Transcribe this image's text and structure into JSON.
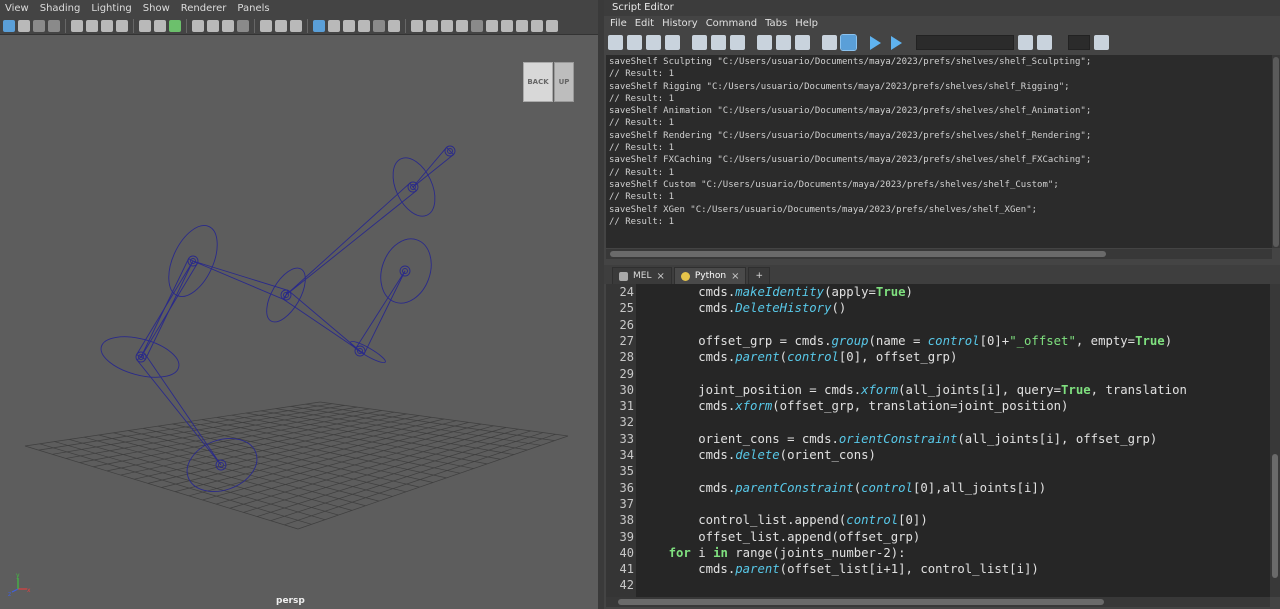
{
  "viewport": {
    "menu": [
      "View",
      "Shading",
      "Lighting",
      "Show",
      "Renderer",
      "Panels"
    ],
    "view_cube": {
      "back": "BACK",
      "up": "UP"
    },
    "camera_label": "persp",
    "axis_labels": {
      "x": "x",
      "y": "y",
      "z": "z"
    }
  },
  "script_editor": {
    "title": "Script Editor",
    "menu": [
      "File",
      "Edit",
      "History",
      "Command",
      "Tabs",
      "Help"
    ],
    "history_lines": [
      "saveShelf Sculpting \"C:/Users/usuario/Documents/maya/2023/prefs/shelves/shelf_Sculpting\";",
      "// Result: 1",
      "saveShelf Rigging \"C:/Users/usuario/Documents/maya/2023/prefs/shelves/shelf_Rigging\";",
      "// Result: 1",
      "saveShelf Animation \"C:/Users/usuario/Documents/maya/2023/prefs/shelves/shelf_Animation\";",
      "// Result: 1",
      "saveShelf Rendering \"C:/Users/usuario/Documents/maya/2023/prefs/shelves/shelf_Rendering\";",
      "// Result: 1",
      "saveShelf FXCaching \"C:/Users/usuario/Documents/maya/2023/prefs/shelves/shelf_FXCaching\";",
      "// Result: 1",
      "saveShelf Custom \"C:/Users/usuario/Documents/maya/2023/prefs/shelves/shelf_Custom\";",
      "// Result: 1",
      "saveShelf XGen \"C:/Users/usuario/Documents/maya/2023/prefs/shelves/shelf_XGen\";",
      "// Result: 1"
    ],
    "tabs": [
      {
        "label": "MEL",
        "active": false
      },
      {
        "label": "Python",
        "active": true
      }
    ],
    "add_tab": "+",
    "tab_close": "×",
    "code_lines": [
      {
        "n": "24",
        "text": "        cmds.makeIdentity(apply=True)"
      },
      {
        "n": "25",
        "text": "        cmds.DeleteHistory()"
      },
      {
        "n": "26",
        "text": ""
      },
      {
        "n": "27",
        "text": "        offset_grp = cmds.group(name = control[0]+\"_offset\", empty=True)"
      },
      {
        "n": "28",
        "text": "        cmds.parent(control[0], offset_grp)"
      },
      {
        "n": "29",
        "text": ""
      },
      {
        "n": "30",
        "text": "        joint_position = cmds.xform(all_joints[i], query=True, translation"
      },
      {
        "n": "31",
        "text": "        cmds.xform(offset_grp, translation=joint_position)"
      },
      {
        "n": "32",
        "text": ""
      },
      {
        "n": "33",
        "text": "        orient_cons = cmds.orientConstraint(all_joints[i], offset_grp)"
      },
      {
        "n": "34",
        "text": "        cmds.delete(orient_cons)"
      },
      {
        "n": "35",
        "text": ""
      },
      {
        "n": "36",
        "text": "        cmds.parentConstraint(control[0],all_joints[i])"
      },
      {
        "n": "37",
        "text": ""
      },
      {
        "n": "38",
        "text": "        control_list.append(control[0])"
      },
      {
        "n": "39",
        "text": "        offset_list.append(offset_grp)"
      },
      {
        "n": "40",
        "text": "    for i in range(joints_number-2):"
      },
      {
        "n": "41",
        "text": "        cmds.parent(offset_list[i+1], control_list[i])"
      },
      {
        "n": "42",
        "text": ""
      }
    ]
  },
  "colors": {
    "keyword": "#7fe07f",
    "function": "#58c8e8",
    "string": "#7fe07f",
    "rig": "#2a2a8a"
  }
}
